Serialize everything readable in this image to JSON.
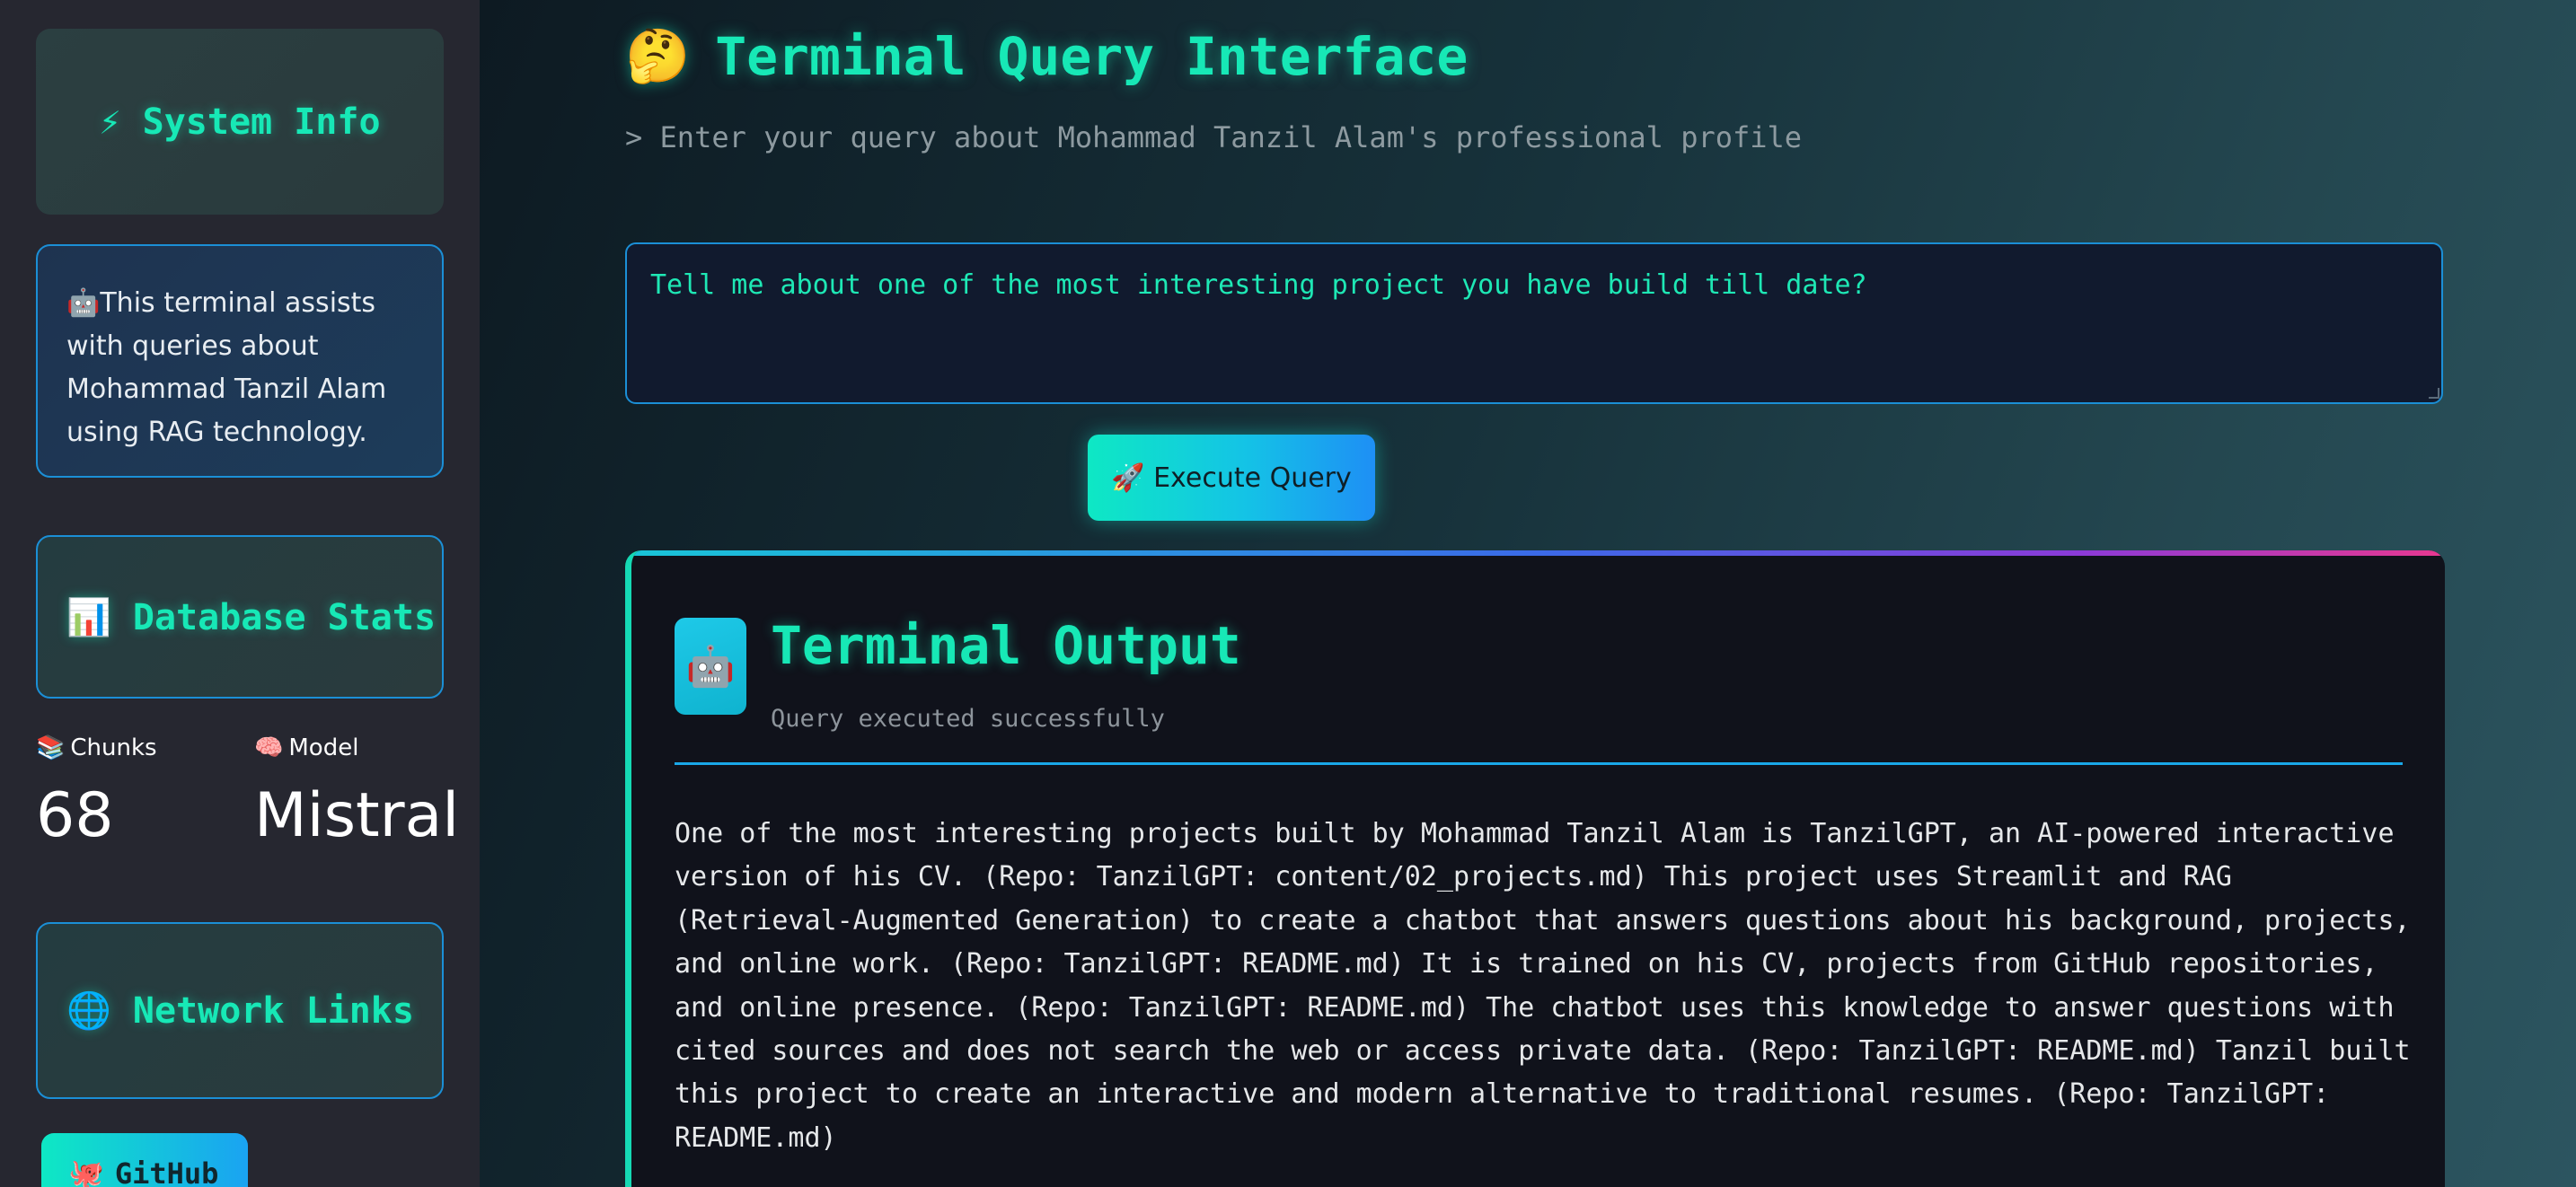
{
  "sidebar": {
    "system_info_title": "⚡ System Info",
    "info_text": "🤖This terminal assists with queries about Mohammad Tanzil Alam using RAG technology.",
    "db_stats_title": "📊 Database Stats",
    "metrics": [
      {
        "icon": "📚",
        "label": "Chunks",
        "value": "68"
      },
      {
        "icon": "🧠",
        "label": "Model",
        "value": "Mistral"
      }
    ],
    "network_links_title": "🌐 Network Links",
    "github_icon": "🐙",
    "github_label": "GitHub"
  },
  "main": {
    "title_emoji": "🤔",
    "title": "Terminal Query Interface",
    "subtitle": "> Enter your query about Mohammad Tanzil Alam's professional profile",
    "query_value": "Tell me about one of the most interesting project you have build till date?",
    "execute_button": "🚀 Execute Query",
    "output": {
      "avatar": "🤖",
      "title": "Terminal Output",
      "status": "Query executed successfully",
      "text": "One of the most interesting projects built by Mohammad Tanzil Alam is TanzilGPT, an AI-powered interactive version of his CV. (Repo: TanzilGPT: content/02_projects.md) This project uses Streamlit and RAG (Retrieval-Augmented Generation) to create a chatbot that answers questions about his background, projects, and online work. (Repo: TanzilGPT: README.md) It is trained on his CV, projects from GitHub repositories, and online presence. (Repo: TanzilGPT: README.md) The chatbot uses this knowledge to answer questions with cited sources and does not search the web or access private data. (Repo: TanzilGPT: README.md) Tanzil built this project to create an interactive and modern alternative to traditional resumes. (Repo: TanzilGPT: README.md)"
    }
  },
  "colors": {
    "accent_green": "#17e8b6",
    "accent_blue": "#1b8fd6",
    "sidebar_bg": "#262730"
  }
}
